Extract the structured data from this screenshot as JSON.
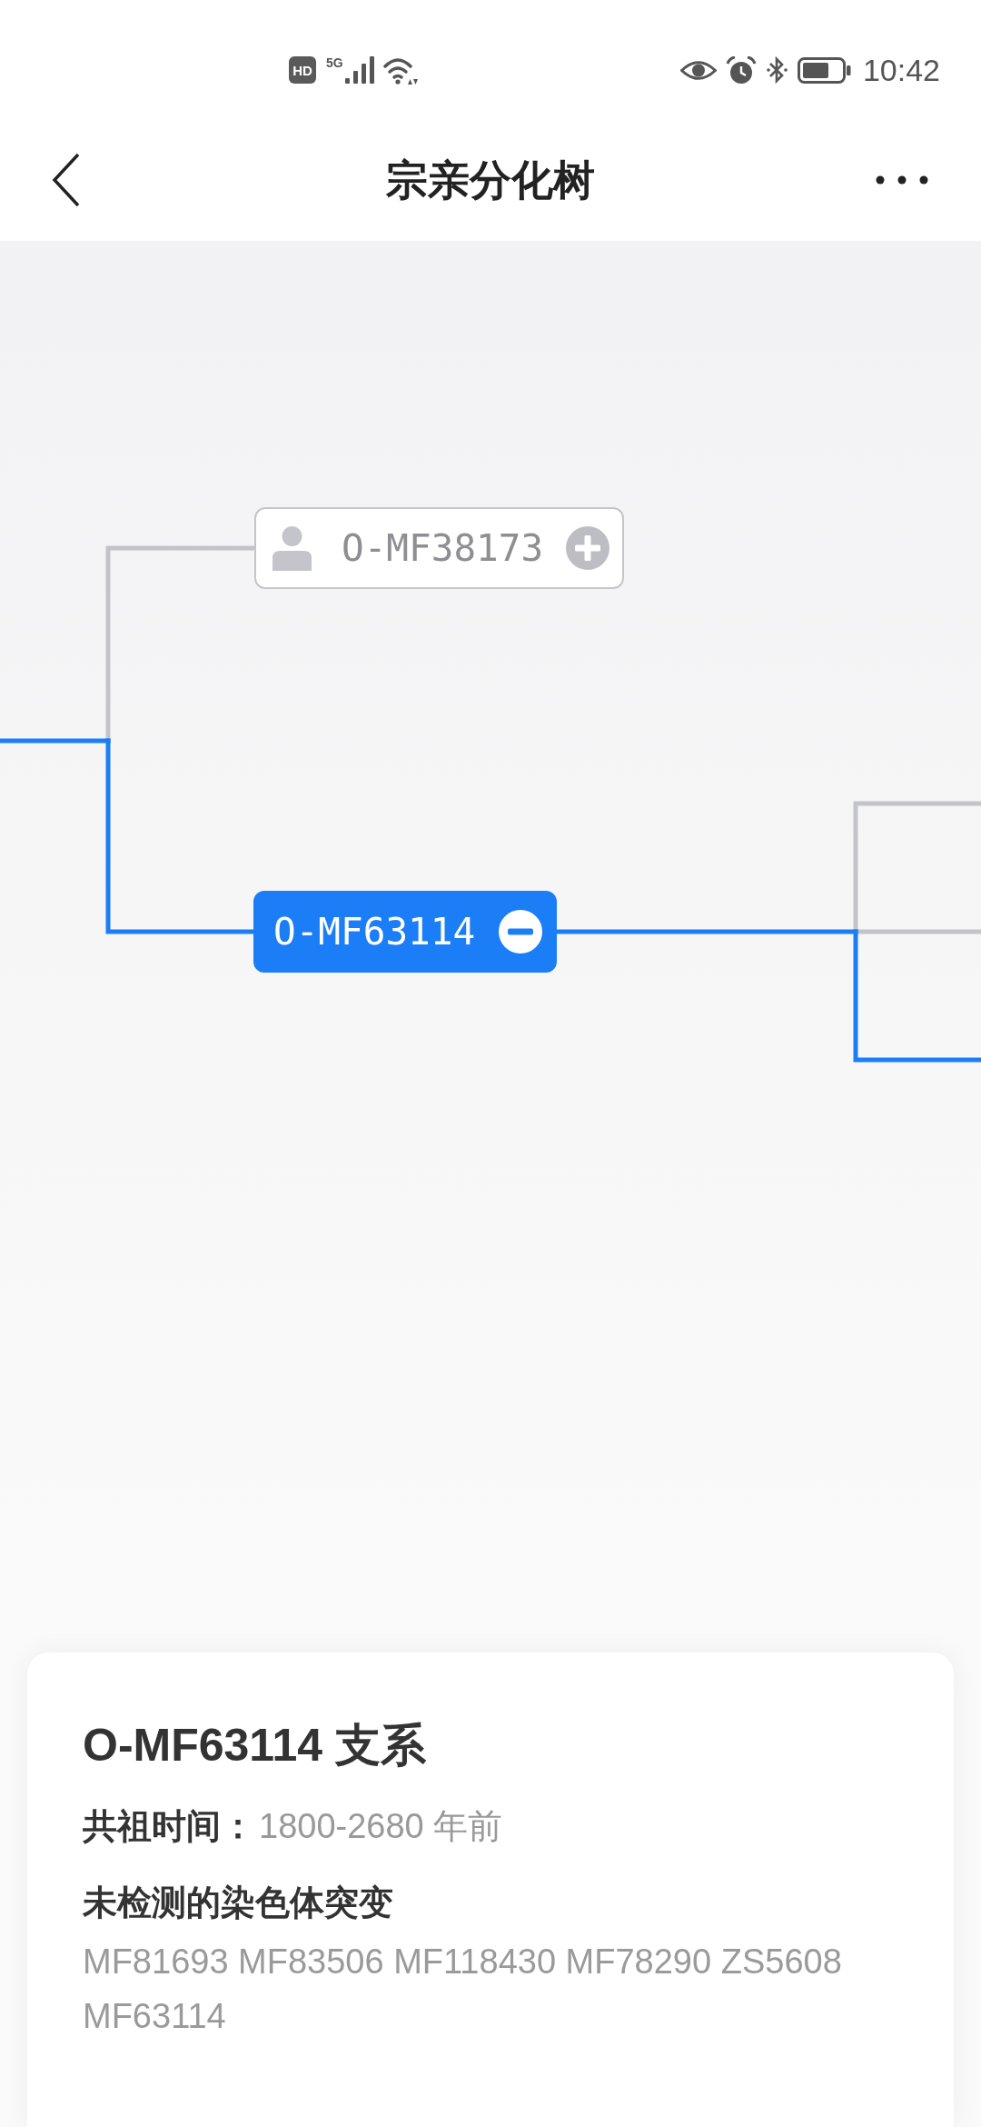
{
  "status_bar": {
    "hd": "HD",
    "network": "5G",
    "time": "10:42"
  },
  "header": {
    "title": "宗亲分化树"
  },
  "tree": {
    "nodes": [
      {
        "label": "O-MF38173",
        "has_members": true,
        "selected": false,
        "expanded": false,
        "on_path": false
      },
      {
        "label": "O-MF63114",
        "has_members": false,
        "selected": true,
        "expanded": true,
        "on_path": true,
        "offscreen_branches": [
          {
            "on_path": false
          },
          {
            "on_path": false
          },
          {
            "on_path": true
          }
        ]
      }
    ]
  },
  "card": {
    "title": "O-MF63114 支系",
    "rows": [
      {
        "label": "共祖时间：",
        "value": "1800-2680 年前"
      }
    ],
    "heading": "未检测的染色体突变",
    "text": "MF81693 MF83506 MF118430 MF78290 ZS5608 MF63114"
  }
}
